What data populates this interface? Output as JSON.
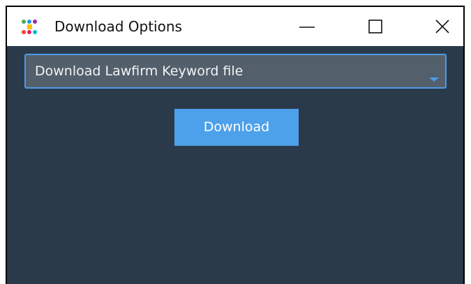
{
  "window": {
    "title": "Download Options"
  },
  "icons": {
    "app": "app-icon",
    "minimize": "minimize-icon",
    "maximize": "maximize-icon",
    "close": "close-icon",
    "dropdown": "chevron-down-icon"
  },
  "form": {
    "selected_option": "Download Lawfirm Keyword file",
    "download_label": "Download"
  },
  "colors": {
    "background": "#2b3a4b",
    "combo_bg": "#535f6b",
    "accent": "#4d9be6",
    "button": "#4da0ea"
  }
}
